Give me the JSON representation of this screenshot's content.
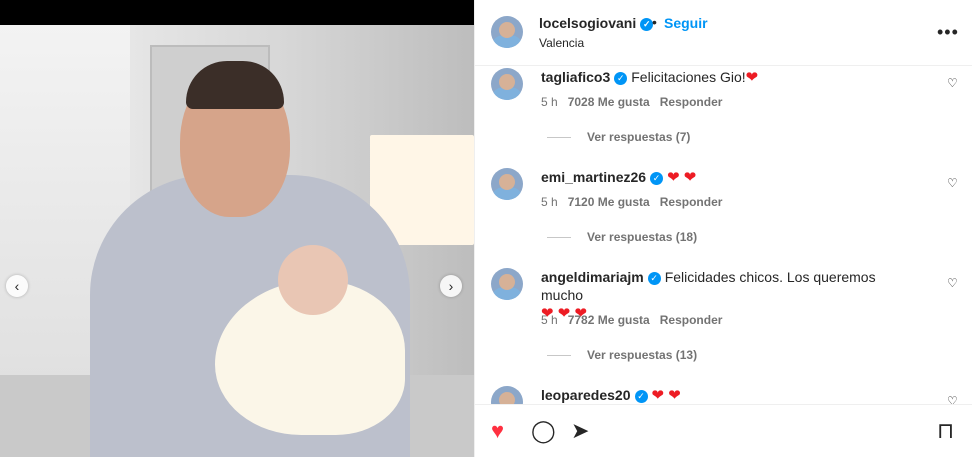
{
  "post": {
    "username": "locelsogiovani",
    "dot": "•",
    "follow_label": "Seguir",
    "location": "Valencia",
    "more_label": "•••"
  },
  "media": {
    "prev_label": "‹",
    "next_label": "›"
  },
  "comments": [
    {
      "username": "tagliafico3",
      "text": "Felicitaciones Gio!",
      "emoji": "❤",
      "time": "5 h",
      "likes": "7028 Me gusta",
      "reply_label": "Responder",
      "replies_label": "Ver respuestas (7)"
    },
    {
      "username": "emi_martinez26",
      "text": "",
      "emoji": "❤ ❤",
      "time": "5 h",
      "likes": "7120 Me gusta",
      "reply_label": "Responder",
      "replies_label": "Ver respuestas (18)"
    },
    {
      "username": "angeldimariajm",
      "text": "Felicidades chicos. Los queremos mucho",
      "emoji": "❤ ❤ ❤",
      "time": "5 h",
      "likes": "7782 Me gusta",
      "reply_label": "Responder",
      "replies_label": "Ver respuestas (13)"
    },
    {
      "username": "leoparedes20",
      "text": "",
      "emoji": "❤ ❤"
    }
  ],
  "icons": {
    "heart_small": "♡",
    "like": "♥",
    "comment": "◯",
    "share": "➤",
    "save": "⊓",
    "verified": "✓"
  },
  "colors": {
    "accent": "#0095f6",
    "like": "#ff3040",
    "verified": "#0095f6"
  }
}
